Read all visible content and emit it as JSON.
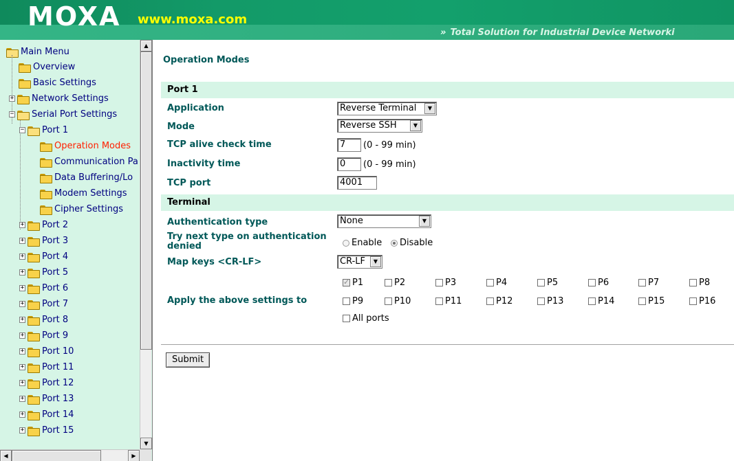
{
  "header": {
    "logo": "MOXA",
    "url": "www.moxa.com",
    "tagline": "Total Solution for Industrial Device Networki",
    "tagline_icon": "double-chevron-right-icon"
  },
  "sidebar": {
    "root": "Main Menu",
    "items": [
      {
        "label": "Overview"
      },
      {
        "label": "Basic Settings"
      },
      {
        "label": "Network Settings"
      },
      {
        "label": "Serial Port Settings"
      },
      {
        "label": "Port 1"
      },
      {
        "label": "Operation Modes"
      },
      {
        "label": "Communication Pa"
      },
      {
        "label": "Data Buffering/Lo"
      },
      {
        "label": "Modem Settings"
      },
      {
        "label": "Cipher Settings"
      },
      {
        "label": "Port 2"
      },
      {
        "label": "Port 3"
      },
      {
        "label": "Port 4"
      },
      {
        "label": "Port 5"
      },
      {
        "label": "Port 6"
      },
      {
        "label": "Port 7"
      },
      {
        "label": "Port 8"
      },
      {
        "label": "Port 9"
      },
      {
        "label": "Port 10"
      },
      {
        "label": "Port 11"
      },
      {
        "label": "Port 12"
      },
      {
        "label": "Port 13"
      },
      {
        "label": "Port 14"
      },
      {
        "label": "Port 15"
      }
    ],
    "active": "Operation Modes",
    "active_color": "#ff2000"
  },
  "main": {
    "title": "Operation Modes",
    "port_section": "Port 1",
    "fields": {
      "application": {
        "label": "Application",
        "value": "Reverse Terminal"
      },
      "mode": {
        "label": "Mode",
        "value": "Reverse SSH"
      },
      "tcp_alive": {
        "label": "TCP alive check time",
        "value": "7",
        "hint": "(0 - 99 min)"
      },
      "inactivity": {
        "label": "Inactivity time",
        "value": "0",
        "hint": "(0 - 99 min)"
      },
      "tcp_port": {
        "label": "TCP port",
        "value": "4001"
      }
    },
    "terminal_section": "Terminal",
    "terminal": {
      "auth_type": {
        "label": "Authentication type",
        "value": "None"
      },
      "try_next": {
        "label_line1": "Try next type on authentication",
        "label_line2": "denied",
        "enable": "Enable",
        "disable": "Disable",
        "selected": "Disable"
      },
      "map_keys": {
        "label": "Map keys <CR-LF>",
        "value": "CR-LF"
      }
    },
    "apply": {
      "label": "Apply the above settings to",
      "ports": [
        "P1",
        "P2",
        "P3",
        "P4",
        "P5",
        "P6",
        "P7",
        "P8",
        "P9",
        "P10",
        "P11",
        "P12",
        "P13",
        "P14",
        "P15",
        "P16"
      ],
      "checked": [
        "P1"
      ],
      "all_ports": "All ports"
    },
    "submit": "Submit"
  },
  "colors": {
    "header_green": "#13a06c",
    "label_teal": "#005858",
    "section_bg": "#d6f5e6",
    "url_yellow": "#ffff00"
  }
}
